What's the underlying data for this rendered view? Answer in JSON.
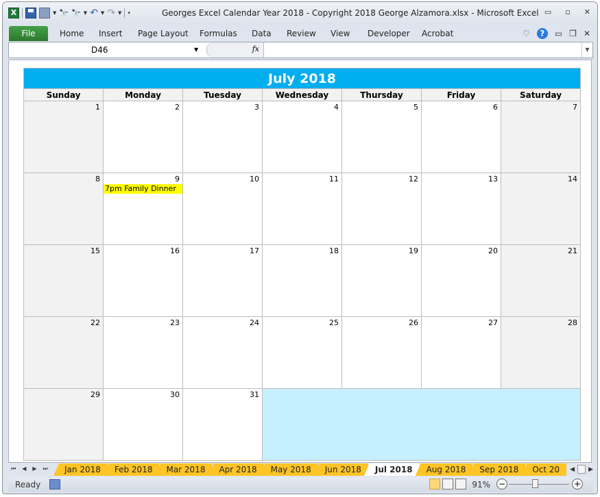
{
  "window": {
    "title": "Georges Excel Calendar Year 2018  -  Copyright 2018 George Alzamora.xlsx  -  Microsoft Excel",
    "controls": {
      "minimize": "▭",
      "restore": "▫",
      "close": "✕"
    }
  },
  "quick_access": {
    "app_icon": "X",
    "undo": "↶",
    "redo": "↷",
    "find": "🔍"
  },
  "ribbon": {
    "file_label": "File",
    "tabs": [
      "Home",
      "Insert",
      "Page Layout",
      "Formulas",
      "Data",
      "Review",
      "View",
      "Developer",
      "Acrobat"
    ],
    "help": "?"
  },
  "formula_bar": {
    "name_box": "D46",
    "fx": "fx",
    "formula": ""
  },
  "calendar": {
    "title": "July 2018",
    "days": [
      "Sunday",
      "Monday",
      "Tuesday",
      "Wednesday",
      "Thursday",
      "Friday",
      "Saturday"
    ],
    "weeks": [
      [
        "1",
        "2",
        "3",
        "4",
        "5",
        "6",
        "7"
      ],
      [
        "8",
        "9",
        "10",
        "11",
        "12",
        "13",
        "14"
      ],
      [
        "15",
        "16",
        "17",
        "18",
        "19",
        "20",
        "21"
      ],
      [
        "22",
        "23",
        "24",
        "25",
        "26",
        "27",
        "28"
      ],
      [
        "29",
        "30",
        "31",
        "",
        "",
        "",
        ""
      ]
    ],
    "events": [
      {
        "day": "9",
        "text": "7pm Family Dinner",
        "color": "#ffff00"
      }
    ],
    "colors": {
      "header": "#00adef",
      "weekend": "#f2f2f2",
      "blank": "#c6efff"
    }
  },
  "sheet_tabs": {
    "tabs": [
      "Jan 2018",
      "Feb 2018",
      "Mar 2018",
      "Apr 2018",
      "May 2018",
      "Jun 2018",
      "Jul 2018",
      "Aug 2018",
      "Sep 2018",
      "Oct 20"
    ],
    "active": "Jul 2018"
  },
  "status": {
    "ready": "Ready",
    "zoom": "91%",
    "zoom_minus": "−",
    "zoom_plus": "+"
  }
}
